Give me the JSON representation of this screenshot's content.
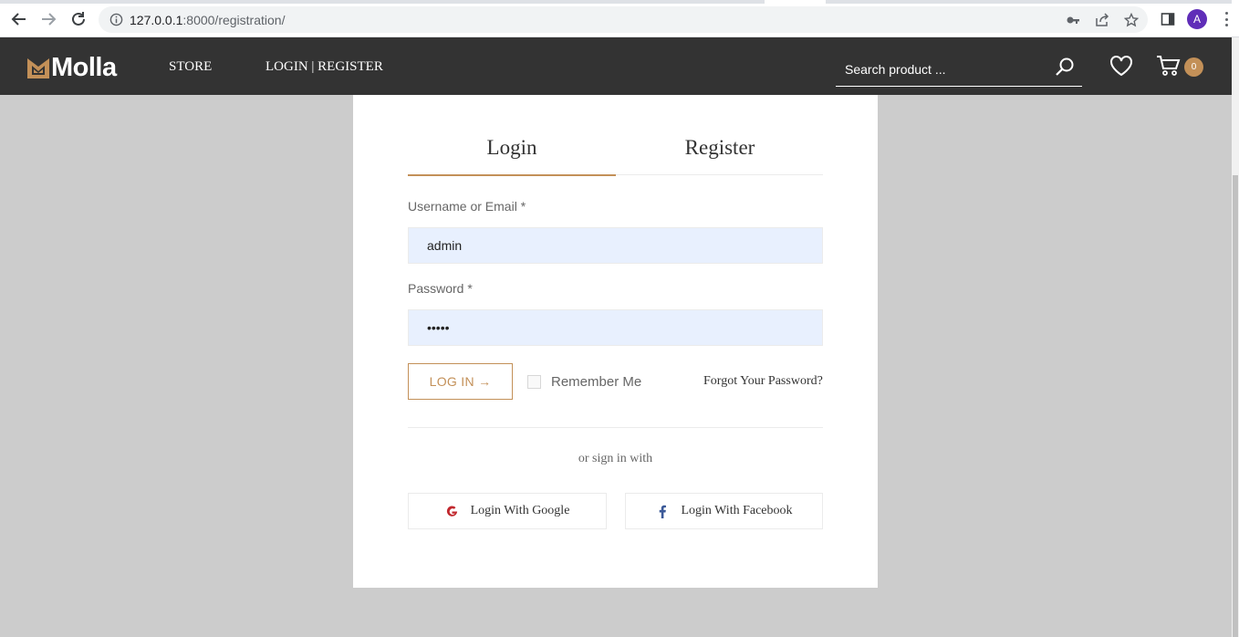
{
  "browser": {
    "url_host": "127.0.0.1",
    "url_rest": ":8000/registration/",
    "profile_initial": "A"
  },
  "header": {
    "brand": "Molla",
    "nav": [
      "STORE",
      "LOGIN | REGISTER"
    ],
    "search_placeholder": "Search product ...",
    "cart_count": "0",
    "colors": {
      "bg": "#333333",
      "accent": "#c39058"
    }
  },
  "form": {
    "tabs": [
      "Login",
      "Register"
    ],
    "active_tab": "Login",
    "username_label": "Username or Email *",
    "username_value": "admin",
    "password_label": "Password *",
    "password_value": "•••••",
    "login_button": "LOG IN  →",
    "remember_label": "Remember Me",
    "forgot_link": "Forgot Your Password?",
    "or_text": "or sign in with",
    "google_button": "Login With Google",
    "facebook_button": "Login With Facebook"
  }
}
